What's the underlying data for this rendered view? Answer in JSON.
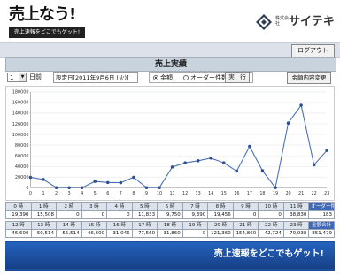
{
  "header": {
    "logo_text": "売上なう!",
    "logo_tagline": "売上速報をどこでもゲット!",
    "brand_prefix": "株式会社",
    "brand_name": "サイテキ",
    "logout_label": "ログアウト"
  },
  "page_title": "売上実績",
  "controls": {
    "day_value": "1",
    "day_unit": "日前",
    "date_label": "設定日[2011年9月6日 (火)]",
    "radio_amount": "金額",
    "radio_orders": "オーダー件数",
    "run_label": "実　行",
    "detail_label": "金額内容変更"
  },
  "chart_data": {
    "type": "line",
    "x": [
      0,
      1,
      2,
      3,
      4,
      5,
      6,
      7,
      8,
      9,
      10,
      11,
      12,
      13,
      14,
      15,
      16,
      17,
      18,
      19,
      20,
      21,
      22,
      23
    ],
    "values": [
      19390,
      15508,
      0,
      0,
      0,
      11833,
      9750,
      9390,
      19456,
      0,
      0,
      38830,
      46600,
      50514,
      55514,
      46600,
      31046,
      77560,
      31860,
      0,
      121360,
      154860,
      42724,
      70038
    ],
    "ylim": [
      0,
      180000
    ],
    "yticks": [
      0,
      20000,
      40000,
      60000,
      80000,
      100000,
      120000,
      140000,
      160000,
      180000
    ],
    "grid": "horizontal",
    "color": "#4a6fb3"
  },
  "table": {
    "row1_headers": [
      "0 時",
      "1 時",
      "2 時",
      "3 時",
      "4 時",
      "5 時",
      "6 時",
      "7 時",
      "8 時",
      "9 時",
      "10 時",
      "11 時",
      "オーダー件数"
    ],
    "row1_values": [
      "19,390",
      "15,508",
      "0",
      "0",
      "0",
      "11,833",
      "9,750",
      "9,390",
      "19,456",
      "0",
      "0",
      "38,830",
      "183"
    ],
    "row2_headers": [
      "12 時",
      "13 時",
      "14 時",
      "15 時",
      "16 時",
      "17 時",
      "18 時",
      "19 時",
      "20 時",
      "21 時",
      "22 時",
      "23 時",
      "金額合計"
    ],
    "row2_values": [
      "46,600",
      "50,514",
      "55,514",
      "46,600",
      "31,046",
      "77,560",
      "31,860",
      "0",
      "121,360",
      "154,860",
      "42,724",
      "70,038",
      "851,479"
    ]
  },
  "banner_text": "売上速報をどこでもゲット!"
}
